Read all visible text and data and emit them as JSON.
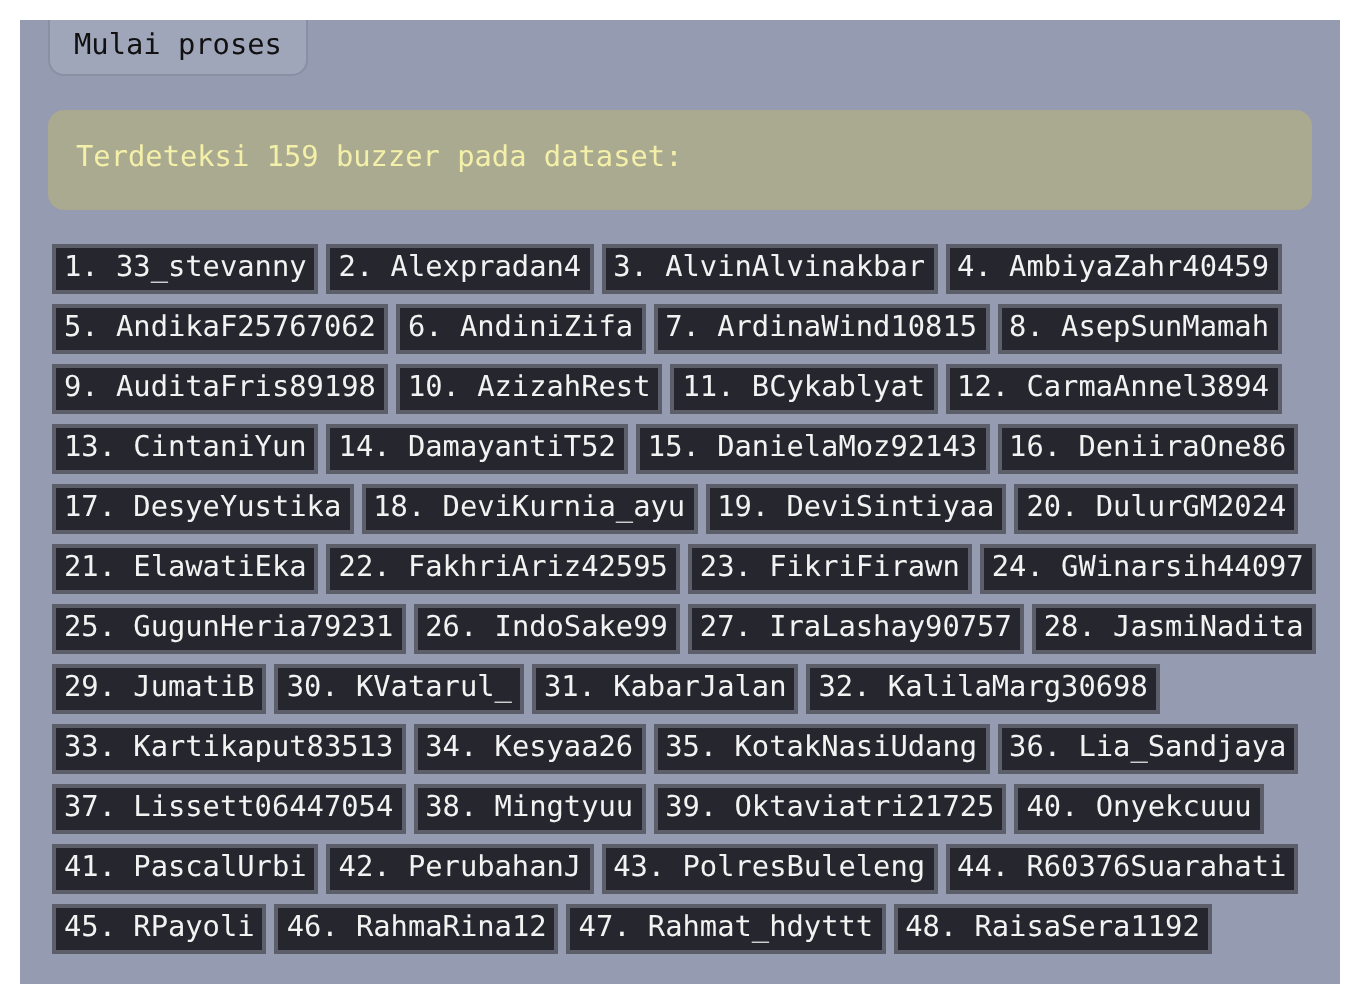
{
  "button": {
    "label": "Mulai proses"
  },
  "alert": {
    "text": "Terdeteksi 159 buzzer pada dataset:"
  },
  "buzzers": [
    "1. 33_stevanny",
    "2. Alexpradan4",
    "3. AlvinAlvinakbar",
    "4. AmbiyaZahr40459",
    "5. AndikaF25767062",
    "6. AndiniZifa",
    "7. ArdinaWind10815",
    "8. AsepSunMamah",
    "9. AuditaFris89198",
    "10. AzizahRest",
    "11. BCykablyat",
    "12. CarmaAnnel3894",
    "13. CintaniYun",
    "14. DamayantiT52",
    "15. DanielaMoz92143",
    "16. DeniiraOne86",
    "17. DesyeYustika",
    "18. DeviKurnia_ayu",
    "19. DeviSintiyaa",
    "20. DulurGM2024",
    "21. ElawatiEka",
    "22. FakhriAriz42595",
    "23. FikriFirawn",
    "24. GWinarsih44097",
    "25. GugunHeria79231",
    "26. IndoSake99",
    "27. IraLashay90757",
    "28. JasmiNadita",
    "29. JumatiB",
    "30. KVatarul_",
    "31. KabarJalan",
    "32. KalilaMarg30698",
    "33. Kartikaput83513",
    "34. Kesyaa26",
    "35. KotakNasiUdang",
    "36. Lia_Sandjaya",
    "37. Lissett06447054",
    "38. Mingtyuu",
    "39. Oktaviatri21725",
    "40. Onyekcuuu",
    "41. PascalUrbi",
    "42. PerubahanJ",
    "43. PolresBuleleng",
    "44. R60376Suarahati",
    "45. RPayoli",
    "46. RahmaRina12",
    "47. Rahmat_hdyttt",
    "48. RaisaSera1192"
  ]
}
